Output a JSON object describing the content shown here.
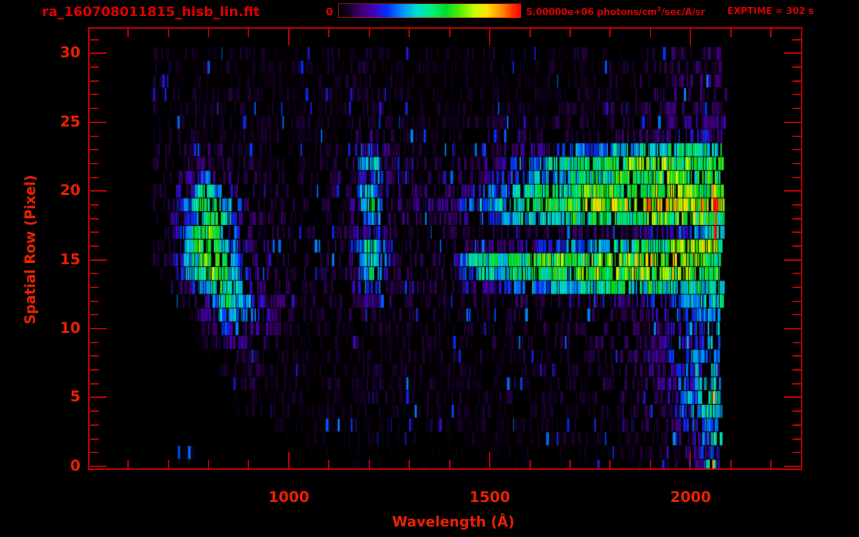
{
  "header": {
    "title": "ra_160708011815_hisb_lin.fit",
    "colorbar": {
      "min_label": "0",
      "max_label": "5.00000e+06",
      "units_prefix": " photons/cm",
      "units_sup": "2",
      "units_suffix": "/sec/A/sr"
    },
    "exptime_label": "EXPTIME = 302 s"
  },
  "axes": {
    "x": {
      "label": "Wavelength (Å)",
      "ticks": [
        1000,
        1500,
        2000
      ],
      "minor_start": 600,
      "minor_end": 2200,
      "minor_step": 100,
      "range": [
        504,
        2278
      ]
    },
    "y": {
      "label": "Spatial Row (Pixel)",
      "ticks": [
        0,
        5,
        10,
        15,
        20,
        25,
        30
      ],
      "minor_step": 1,
      "minor_max": 31,
      "range": [
        -0.26,
        31.8
      ]
    }
  },
  "colors": {
    "background": "#000000",
    "frame": "#c40000",
    "label_text": "#ee2200",
    "header_text": "#e00000"
  },
  "chart_data": {
    "type": "heatmap",
    "title": "ra_160708011815_hisb_lin.fit",
    "xlabel": "Wavelength (Å)",
    "ylabel": "Spatial Row (Pixel)",
    "exposure_time": "302 s",
    "colorbar": {
      "min": 0,
      "max": 5000000,
      "units": "photons/cm^2/sec/A/sr",
      "colormap": "rainbow"
    },
    "value_normalization": "fraction_of_colorbar_max",
    "x_axis_range": [
      504,
      2278
    ],
    "y_axis_range": [
      -0.26,
      31.8
    ],
    "x_data_range": [
      662,
      2086
    ],
    "x_bin_centers": [
      700,
      750,
      800,
      850,
      900,
      950,
      1000,
      1050,
      1100,
      1150,
      1200,
      1250,
      1300,
      1350,
      1400,
      1450,
      1500,
      1550,
      1600,
      1650,
      1700,
      1750,
      1800,
      1850,
      1900,
      1950,
      2000,
      2050
    ],
    "rows": [
      [
        0,
        0,
        0,
        0,
        0,
        0,
        0,
        0,
        0.02,
        0.02,
        0.03,
        0.02,
        0.02,
        0.02,
        0.02,
        0.02,
        0.03,
        0.03,
        0.02,
        0.03,
        0.03,
        0.03,
        0.03,
        0.04,
        0.04,
        0.05,
        0.08,
        0.3
      ],
      [
        0,
        0.05,
        0,
        0,
        0,
        0,
        0,
        0.02,
        0.03,
        0.02,
        0.03,
        0.03,
        0.02,
        0.03,
        0.03,
        0.02,
        0.03,
        0.03,
        0.03,
        0.03,
        0.03,
        0.04,
        0.04,
        0.04,
        0.05,
        0.06,
        0.1,
        0.25
      ],
      [
        0,
        0,
        0,
        0,
        0,
        0,
        0.03,
        0.03,
        0.04,
        0.03,
        0.04,
        0.04,
        0.03,
        0.04,
        0.03,
        0.04,
        0.04,
        0.04,
        0.04,
        0.04,
        0.05,
        0.05,
        0.05,
        0.05,
        0.06,
        0.08,
        0.15,
        0.3
      ],
      [
        0,
        0,
        0,
        0,
        0,
        0.04,
        0.04,
        0.04,
        0.04,
        0.05,
        0.05,
        0.04,
        0.04,
        0.04,
        0.04,
        0.04,
        0.05,
        0.05,
        0.05,
        0.05,
        0.05,
        0.05,
        0.06,
        0.06,
        0.07,
        0.1,
        0.22,
        0.35
      ],
      [
        0,
        0,
        0,
        0,
        0.05,
        0.04,
        0.05,
        0.04,
        0.05,
        0.04,
        0.05,
        0.04,
        0.05,
        0.04,
        0.04,
        0.05,
        0.05,
        0.05,
        0.05,
        0.05,
        0.05,
        0.06,
        0.06,
        0.07,
        0.08,
        0.14,
        0.28,
        0.44
      ],
      [
        0,
        0,
        0,
        0,
        0.05,
        0.05,
        0.04,
        0.05,
        0.04,
        0.05,
        0.06,
        0.05,
        0.04,
        0.04,
        0.05,
        0.05,
        0.05,
        0.05,
        0.05,
        0.05,
        0.06,
        0.06,
        0.06,
        0.07,
        0.09,
        0.16,
        0.3,
        0.4
      ],
      [
        0,
        0,
        0,
        0.05,
        0.06,
        0.05,
        0.05,
        0.04,
        0.05,
        0.04,
        0.06,
        0.05,
        0.04,
        0.05,
        0.04,
        0.05,
        0.05,
        0.05,
        0.05,
        0.06,
        0.06,
        0.06,
        0.07,
        0.07,
        0.1,
        0.18,
        0.3,
        0.38
      ],
      [
        0,
        0,
        0,
        0.06,
        0.06,
        0.05,
        0.05,
        0.04,
        0.05,
        0.05,
        0.06,
        0.05,
        0.05,
        0.04,
        0.05,
        0.05,
        0.05,
        0.05,
        0.06,
        0.06,
        0.06,
        0.06,
        0.07,
        0.08,
        0.1,
        0.16,
        0.26,
        0.3
      ],
      [
        0,
        0,
        0.05,
        0.07,
        0.06,
        0.06,
        0.05,
        0.05,
        0.05,
        0.05,
        0.07,
        0.05,
        0.05,
        0.05,
        0.05,
        0.05,
        0.05,
        0.06,
        0.06,
        0.06,
        0.06,
        0.07,
        0.07,
        0.08,
        0.12,
        0.2,
        0.3,
        0.35
      ],
      [
        0,
        0,
        0.06,
        0.15,
        0.12,
        0.06,
        0.05,
        0.05,
        0.05,
        0.05,
        0.07,
        0.06,
        0.05,
        0.05,
        0.05,
        0.05,
        0.06,
        0.06,
        0.06,
        0.06,
        0.07,
        0.07,
        0.07,
        0.08,
        0.1,
        0.18,
        0.28,
        0.32
      ],
      [
        0,
        0,
        0.08,
        0.3,
        0.22,
        0.08,
        0.06,
        0.05,
        0.05,
        0.05,
        0.08,
        0.06,
        0.05,
        0.05,
        0.05,
        0.06,
        0.06,
        0.06,
        0.06,
        0.07,
        0.07,
        0.07,
        0.08,
        0.08,
        0.1,
        0.15,
        0.25,
        0.3
      ],
      [
        0,
        0.06,
        0.15,
        0.42,
        0.35,
        0.12,
        0.07,
        0.06,
        0.05,
        0.06,
        0.1,
        0.07,
        0.06,
        0.05,
        0.06,
        0.06,
        0.06,
        0.07,
        0.07,
        0.07,
        0.08,
        0.08,
        0.08,
        0.1,
        0.14,
        0.22,
        0.3,
        0.35
      ],
      [
        0,
        0.08,
        0.28,
        0.48,
        0.3,
        0.1,
        0.07,
        0.06,
        0.06,
        0.06,
        0.15,
        0.08,
        0.06,
        0.06,
        0.06,
        0.07,
        0.07,
        0.08,
        0.08,
        0.08,
        0.09,
        0.09,
        0.1,
        0.12,
        0.18,
        0.3,
        0.38,
        0.42
      ],
      [
        0.05,
        0.15,
        0.45,
        0.55,
        0.25,
        0.1,
        0.07,
        0.06,
        0.06,
        0.07,
        0.35,
        0.1,
        0.07,
        0.07,
        0.08,
        0.12,
        0.18,
        0.22,
        0.28,
        0.35,
        0.4,
        0.45,
        0.48,
        0.5,
        0.52,
        0.5,
        0.48,
        0.46
      ],
      [
        0.06,
        0.3,
        0.6,
        0.5,
        0.18,
        0.08,
        0.07,
        0.06,
        0.07,
        0.08,
        0.5,
        0.12,
        0.08,
        0.08,
        0.1,
        0.3,
        0.45,
        0.48,
        0.52,
        0.55,
        0.58,
        0.6,
        0.62,
        0.64,
        0.66,
        0.68,
        0.62,
        0.56
      ],
      [
        0.06,
        0.4,
        0.72,
        0.45,
        0.15,
        0.08,
        0.07,
        0.07,
        0.07,
        0.08,
        0.55,
        0.12,
        0.08,
        0.09,
        0.1,
        0.4,
        0.48,
        0.52,
        0.55,
        0.58,
        0.6,
        0.62,
        0.64,
        0.68,
        0.72,
        0.7,
        0.64,
        0.56
      ],
      [
        0.06,
        0.45,
        0.68,
        0.35,
        0.12,
        0.08,
        0.07,
        0.06,
        0.07,
        0.08,
        0.5,
        0.1,
        0.07,
        0.08,
        0.08,
        0.1,
        0.12,
        0.14,
        0.16,
        0.18,
        0.28,
        0.35,
        0.42,
        0.48,
        0.55,
        0.6,
        0.65,
        0.62
      ],
      [
        0.06,
        0.4,
        0.62,
        0.3,
        0.1,
        0.07,
        0.06,
        0.06,
        0.06,
        0.07,
        0.25,
        0.08,
        0.06,
        0.06,
        0.06,
        0.07,
        0.07,
        0.07,
        0.08,
        0.08,
        0.08,
        0.09,
        0.1,
        0.1,
        0.12,
        0.16,
        0.28,
        0.48
      ],
      [
        0.07,
        0.3,
        0.58,
        0.35,
        0.12,
        0.08,
        0.07,
        0.06,
        0.07,
        0.08,
        0.4,
        0.12,
        0.08,
        0.1,
        0.12,
        0.16,
        0.25,
        0.35,
        0.42,
        0.46,
        0.5,
        0.52,
        0.55,
        0.58,
        0.6,
        0.62,
        0.65,
        0.58
      ],
      [
        0.07,
        0.35,
        0.62,
        0.3,
        0.1,
        0.07,
        0.07,
        0.07,
        0.07,
        0.08,
        0.55,
        0.14,
        0.1,
        0.12,
        0.15,
        0.22,
        0.35,
        0.45,
        0.52,
        0.58,
        0.62,
        0.66,
        0.7,
        0.74,
        0.78,
        0.8,
        0.74,
        0.78
      ],
      [
        0.07,
        0.25,
        0.5,
        0.18,
        0.08,
        0.07,
        0.06,
        0.06,
        0.07,
        0.08,
        0.45,
        0.12,
        0.08,
        0.1,
        0.12,
        0.16,
        0.25,
        0.35,
        0.45,
        0.52,
        0.58,
        0.62,
        0.65,
        0.68,
        0.7,
        0.72,
        0.68,
        0.65
      ],
      [
        0.06,
        0.15,
        0.3,
        0.12,
        0.07,
        0.06,
        0.06,
        0.06,
        0.06,
        0.07,
        0.3,
        0.1,
        0.08,
        0.08,
        0.08,
        0.1,
        0.15,
        0.22,
        0.32,
        0.4,
        0.46,
        0.5,
        0.54,
        0.56,
        0.58,
        0.6,
        0.58,
        0.55
      ],
      [
        0.06,
        0.08,
        0.14,
        0.08,
        0.06,
        0.06,
        0.05,
        0.06,
        0.06,
        0.07,
        0.48,
        0.1,
        0.07,
        0.07,
        0.08,
        0.1,
        0.14,
        0.2,
        0.3,
        0.4,
        0.48,
        0.54,
        0.58,
        0.6,
        0.62,
        0.64,
        0.62,
        0.58
      ],
      [
        0.05,
        0.06,
        0.08,
        0.06,
        0.05,
        0.05,
        0.05,
        0.05,
        0.05,
        0.06,
        0.3,
        0.08,
        0.06,
        0.06,
        0.06,
        0.07,
        0.08,
        0.1,
        0.14,
        0.18,
        0.25,
        0.32,
        0.38,
        0.42,
        0.46,
        0.5,
        0.52,
        0.48
      ],
      [
        0.05,
        0.05,
        0.04,
        0.05,
        0.05,
        0.05,
        0.05,
        0.04,
        0.05,
        0.05,
        0.1,
        0.06,
        0.05,
        0.05,
        0.05,
        0.05,
        0.06,
        0.06,
        0.06,
        0.06,
        0.07,
        0.07,
        0.08,
        0.09,
        0.11,
        0.14,
        0.18,
        0.15
      ],
      [
        0.04,
        0.05,
        0.05,
        0.04,
        0.05,
        0.04,
        0.05,
        0.05,
        0.04,
        0.05,
        0.08,
        0.05,
        0.05,
        0.04,
        0.05,
        0.05,
        0.05,
        0.06,
        0.05,
        0.06,
        0.06,
        0.07,
        0.06,
        0.07,
        0.09,
        0.12,
        0.14,
        0.12
      ],
      [
        0.05,
        0.04,
        0.05,
        0.05,
        0.04,
        0.05,
        0.04,
        0.05,
        0.05,
        0.04,
        0.07,
        0.05,
        0.04,
        0.05,
        0.04,
        0.05,
        0.05,
        0.05,
        0.06,
        0.05,
        0.06,
        0.05,
        0.07,
        0.06,
        0.08,
        0.1,
        0.12,
        0.1
      ],
      [
        0.04,
        0.05,
        0.04,
        0.05,
        0.05,
        0.04,
        0.05,
        0.04,
        0.05,
        0.05,
        0.06,
        0.05,
        0.05,
        0.04,
        0.05,
        0.05,
        0.04,
        0.05,
        0.05,
        0.04,
        0.05,
        0.06,
        0.05,
        0.06,
        0.07,
        0.09,
        0.1,
        0.09
      ],
      [
        0.05,
        0.04,
        0.05,
        0.04,
        0.05,
        0.05,
        0.04,
        0.05,
        0.04,
        0.05,
        0.07,
        0.05,
        0.04,
        0.05,
        0.05,
        0.04,
        0.05,
        0.04,
        0.05,
        0.05,
        0.06,
        0.05,
        0.05,
        0.06,
        0.08,
        0.1,
        0.12,
        0.1
      ],
      [
        0.04,
        0.05,
        0.04,
        0.05,
        0.04,
        0.05,
        0.04,
        0.05,
        0.05,
        0.04,
        0.06,
        0.04,
        0.05,
        0.04,
        0.05,
        0.04,
        0.05,
        0.05,
        0.04,
        0.05,
        0.05,
        0.05,
        0.06,
        0.05,
        0.07,
        0.08,
        0.1,
        0.08
      ],
      [
        0.05,
        0.05,
        0.05,
        0.04,
        0.05,
        0.04,
        0.05,
        0.04,
        0.05,
        0.04,
        0.06,
        0.05,
        0.04,
        0.05,
        0.04,
        0.05,
        0.05,
        0.04,
        0.05,
        0.05,
        0.05,
        0.06,
        0.05,
        0.06,
        0.06,
        0.1,
        0.12,
        0.1
      ]
    ],
    "spikes": [
      {
        "row": 19,
        "lambda": 1962,
        "value": 0.92,
        "width": 3
      },
      {
        "row": 19,
        "lambda": 2056,
        "value": 1.0,
        "width": 4
      },
      {
        "row": 18,
        "lambda": 2060,
        "value": 0.95,
        "width": 3
      },
      {
        "row": 17,
        "lambda": 2058,
        "value": 1.0,
        "width": 4
      },
      {
        "row": 20,
        "lambda": 2052,
        "value": 0.9,
        "width": 3
      },
      {
        "row": 5,
        "lambda": 2055,
        "value": 0.85,
        "width": 3
      },
      {
        "row": 1,
        "lambda": 724,
        "value": 0.3,
        "width": 3
      },
      {
        "row": 0,
        "lambda": 2054,
        "value": 0.88,
        "width": 3
      },
      {
        "row": 0,
        "lambda": 2042,
        "value": 0.55,
        "width": 3
      }
    ],
    "colormap_stops": [
      [
        0.0,
        "#000000"
      ],
      [
        0.05,
        "#12001f"
      ],
      [
        0.12,
        "#3c0070"
      ],
      [
        0.19,
        "#4400b8"
      ],
      [
        0.27,
        "#0030ff"
      ],
      [
        0.35,
        "#0090ff"
      ],
      [
        0.43,
        "#00dcd0"
      ],
      [
        0.51,
        "#00f080"
      ],
      [
        0.59,
        "#00dc28"
      ],
      [
        0.67,
        "#58f000"
      ],
      [
        0.75,
        "#c8ff00"
      ],
      [
        0.82,
        "#ffe000"
      ],
      [
        0.9,
        "#ff8800"
      ],
      [
        0.96,
        "#ff3000"
      ],
      [
        1.0,
        "#ff0000"
      ]
    ]
  }
}
